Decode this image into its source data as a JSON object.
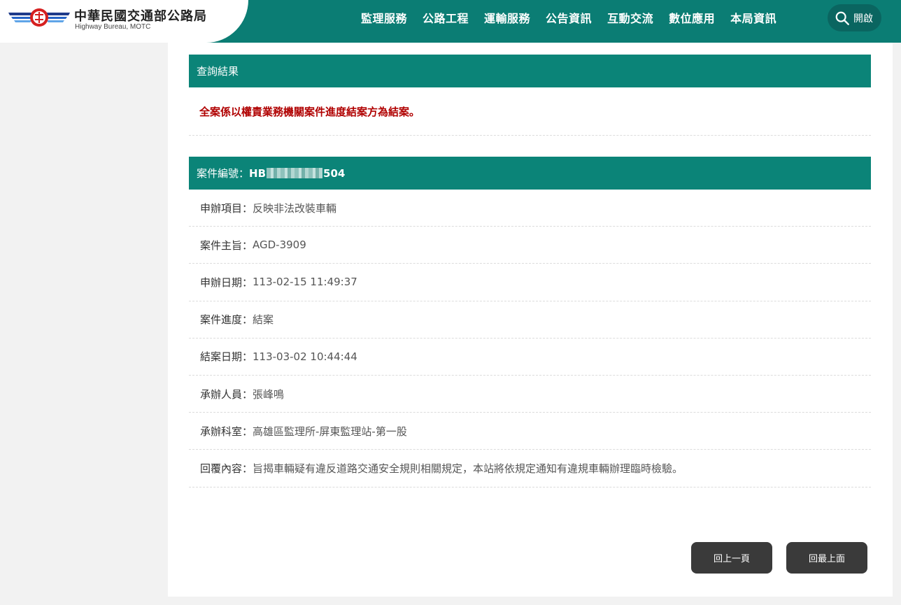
{
  "header": {
    "logo_zh": "中華民國交通部公路局",
    "logo_en": "Highway Bureau, MOTC",
    "nav": [
      "監理服務",
      "公路工程",
      "運輸服務",
      "公告資訊",
      "互動交流",
      "數位應用",
      "本局資訊"
    ],
    "search_label": "開啟",
    "search_icon": "search-icon"
  },
  "result": {
    "title": "查詢結果",
    "notice": "全案係以權責業務機關案件進度結案方為結案。"
  },
  "case": {
    "number_label": "案件編號：",
    "number_prefix": "HB",
    "number_suffix": "504",
    "rows": [
      {
        "label": "申辦項目：",
        "value": "反映非法改裝車輛"
      },
      {
        "label": "案件主旨：",
        "value": "AGD-3909"
      },
      {
        "label": "申辦日期：",
        "value": "113-02-15 11:49:37"
      },
      {
        "label": "案件進度：",
        "value": "結案"
      },
      {
        "label": "結案日期：",
        "value": "113-03-02 10:44:44"
      },
      {
        "label": "承辦人員：",
        "value": "張峰鳴"
      },
      {
        "label": "承辦科室：",
        "value": "高雄區監理所-屏東監理站-第一股"
      },
      {
        "label": "回覆內容：",
        "value": "旨揭車輛疑有違反道路交通安全規則相關規定，本站將依規定通知有違規車輛辦理臨時檢驗。"
      }
    ]
  },
  "buttons": {
    "prev": "回上一頁",
    "top": "回最上面"
  },
  "colors": {
    "brand_teal": "#0b7d74",
    "notice_red": "#b00000",
    "button_dark": "#3a3a3a"
  }
}
